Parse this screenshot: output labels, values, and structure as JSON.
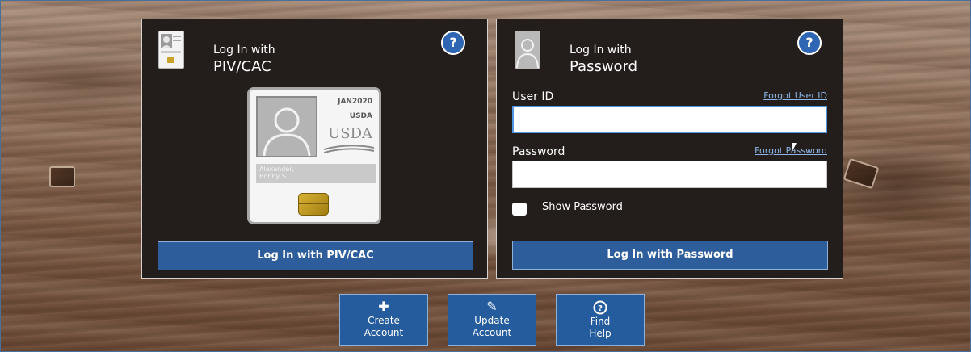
{
  "piv": {
    "title_line1": "Log In with",
    "title_line2": "PIV/CAC",
    "help_label": "?",
    "card": {
      "date": "JAN2020",
      "agency": "USDA",
      "logo": "USDA",
      "name": "Alexander,\nBobby S."
    },
    "button_label": "Log In with PIV/CAC"
  },
  "password": {
    "title_line1": "Log In with",
    "title_line2": "Password",
    "help_label": "?",
    "user_id_label": "User ID",
    "forgot_user_id": "Forgot User ID",
    "user_id_value": "",
    "password_label": "Password",
    "forgot_password": "Forgot Password",
    "password_value": "",
    "show_password_label": "Show Password",
    "button_label": "Log In with Password"
  },
  "tiles": [
    {
      "icon": "plus-icon",
      "line1": "Create",
      "line2": "Account"
    },
    {
      "icon": "pencil-icon",
      "line1": "Update",
      "line2": "Account"
    },
    {
      "icon": "question-circle-icon",
      "line1": "Find",
      "line2": "Help"
    }
  ],
  "colors": {
    "panel_bg": "#231d1b",
    "button_blue": "#2e5d9b",
    "help_blue": "#2e66b3",
    "link_blue": "#8db6e6"
  }
}
